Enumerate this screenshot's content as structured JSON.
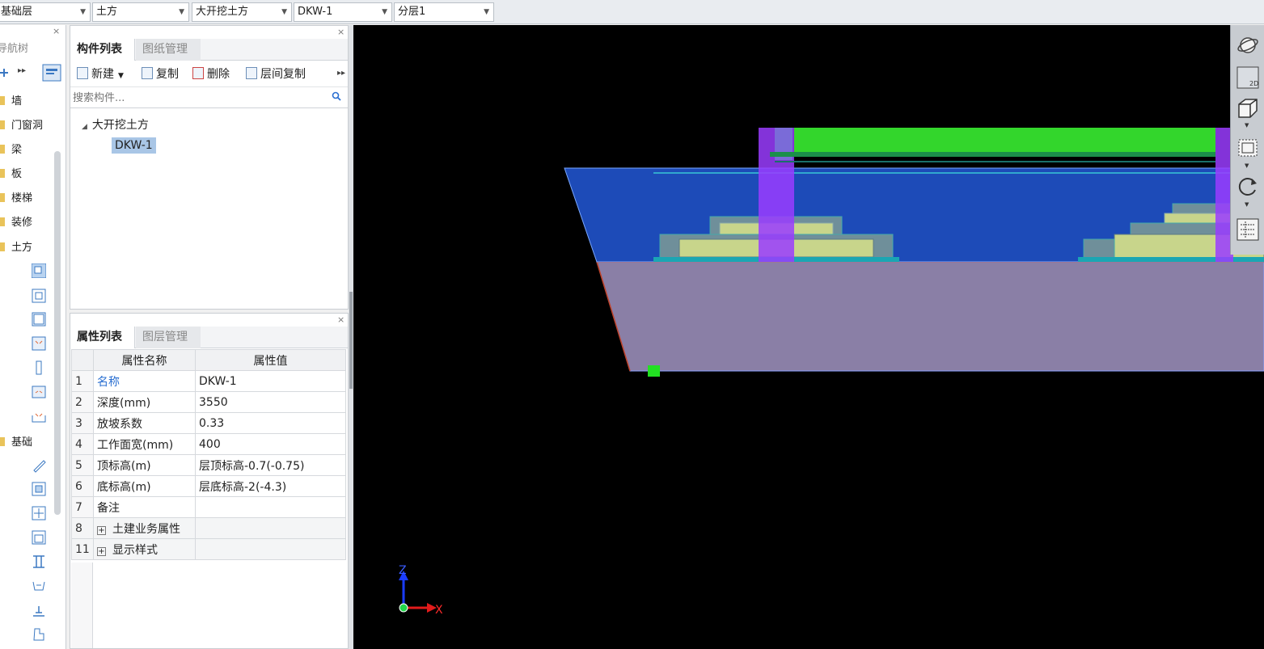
{
  "selectors": {
    "floor": "基础层",
    "category": "土方",
    "type": "大开挖土方",
    "component": "DKW-1",
    "layer": "分层1"
  },
  "nav": {
    "title": "导航树",
    "items": [
      {
        "label": "墙"
      },
      {
        "label": "门窗洞"
      },
      {
        "label": "梁"
      },
      {
        "label": "板"
      },
      {
        "label": "楼梯"
      },
      {
        "label": "装修"
      },
      {
        "label": "土方"
      },
      {
        "label": "基础"
      }
    ]
  },
  "component_panel": {
    "tabs": [
      "构件列表",
      "图纸管理"
    ],
    "toolbar": {
      "new": "新建",
      "copy": "复制",
      "delete": "删除",
      "floor_copy": "层间复制"
    },
    "search_placeholder": "搜索构件...",
    "tree": {
      "group": "大开挖土方",
      "items": [
        "DKW-1"
      ]
    }
  },
  "property_panel": {
    "tabs": [
      "属性列表",
      "图层管理"
    ],
    "headers": {
      "name": "属性名称",
      "value": "属性值"
    },
    "rows": [
      {
        "no": "1",
        "name": "名称",
        "value": "DKW-1"
      },
      {
        "no": "2",
        "name": "深度(mm)",
        "value": "3550"
      },
      {
        "no": "3",
        "name": "放坡系数",
        "value": "0.33"
      },
      {
        "no": "4",
        "name": "工作面宽(mm)",
        "value": "400"
      },
      {
        "no": "5",
        "name": "顶标高(m)",
        "value": "层顶标高-0.7(-0.75)"
      },
      {
        "no": "6",
        "name": "底标高(m)",
        "value": "层底标高-2(-4.3)"
      },
      {
        "no": "7",
        "name": "备注",
        "value": ""
      },
      {
        "no": "8",
        "name": "土建业务属性",
        "value": ""
      },
      {
        "no": "11",
        "name": "显示样式",
        "value": ""
      }
    ]
  },
  "viewport": {
    "axis_z": "Z",
    "axis_x": "X",
    "toolbar_2d_label": "2D"
  }
}
